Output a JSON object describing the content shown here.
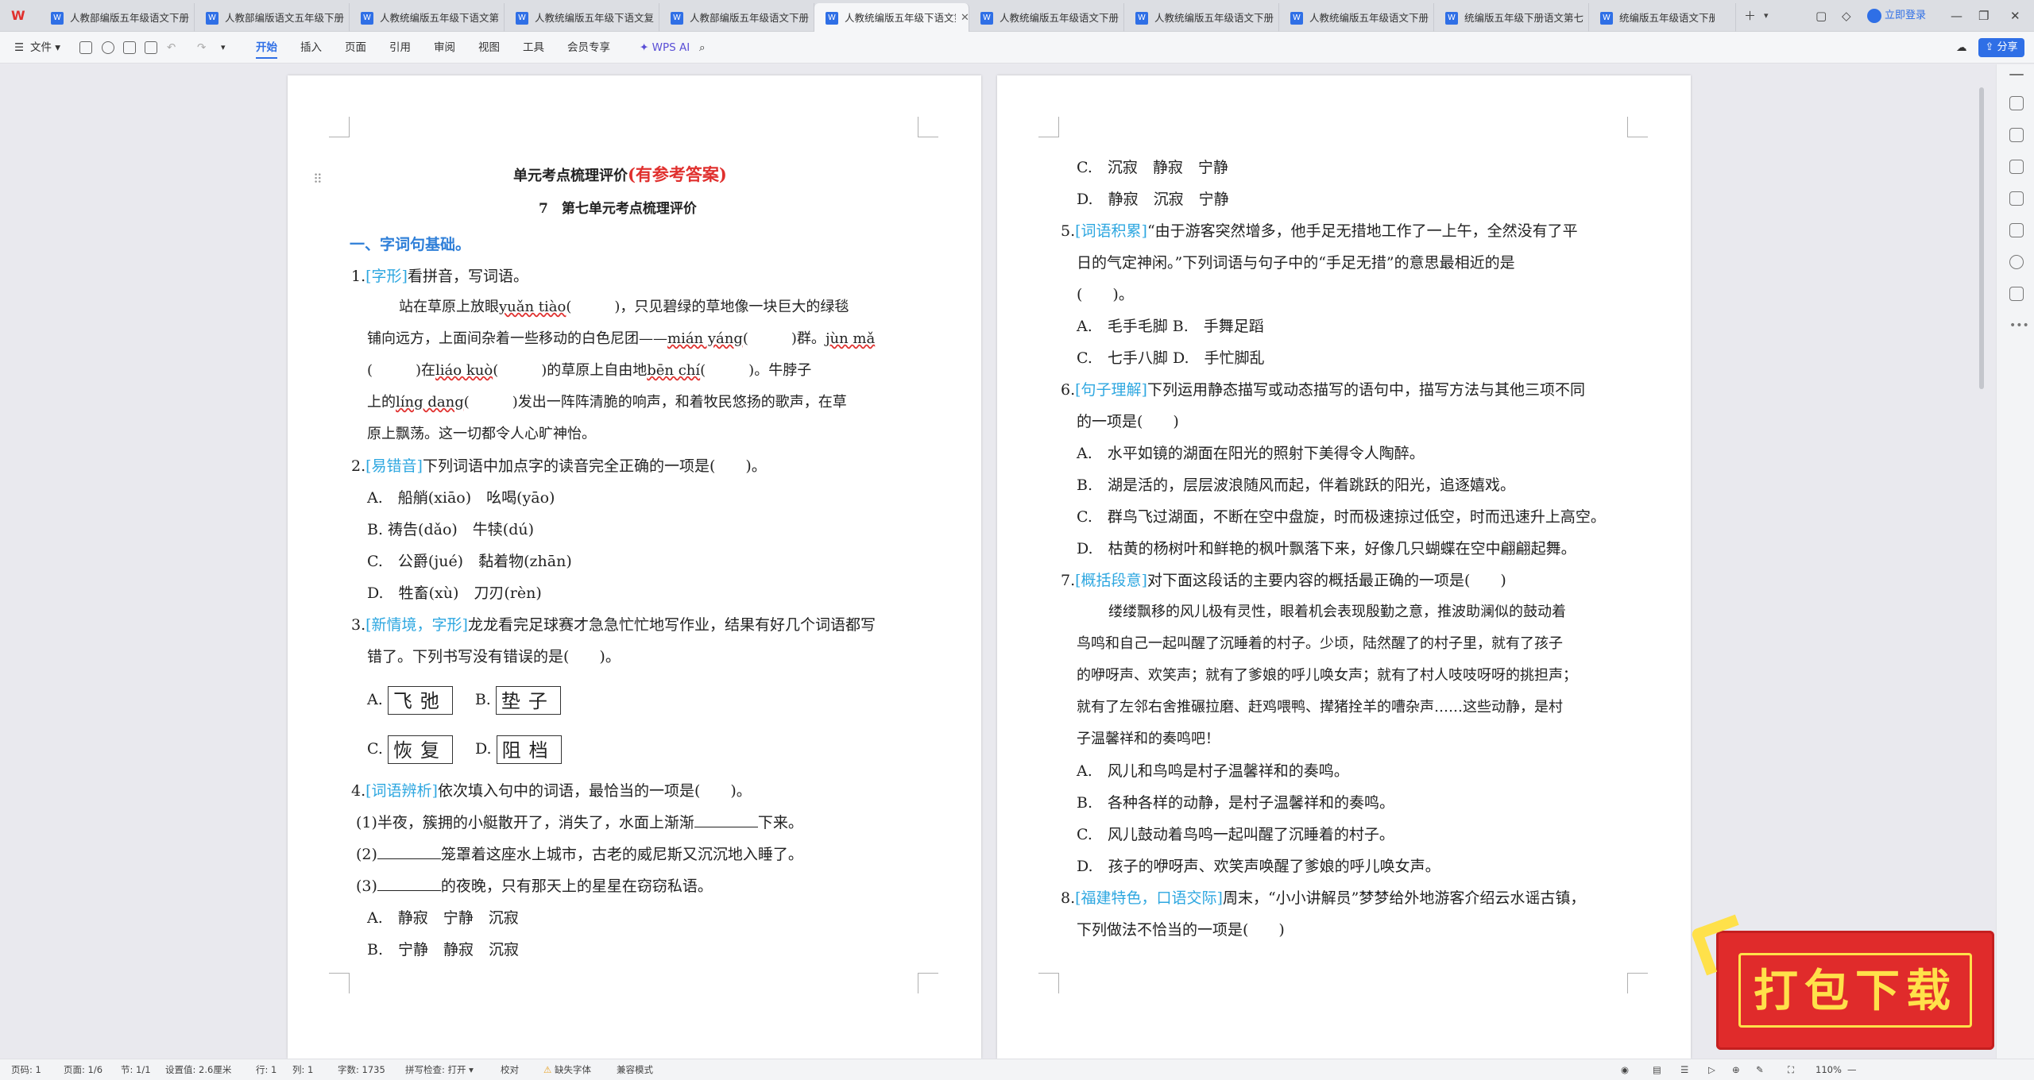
{
  "tabs": [
    {
      "label": "人教部编版五年级语文下册",
      "active": false
    },
    {
      "label": "人教部编版语文五年级下册",
      "active": false
    },
    {
      "label": "人教统编版五年级下语文第",
      "active": false
    },
    {
      "label": "人教统编版五年级下语文复",
      "active": false
    },
    {
      "label": "人教部编版五年级语文下册",
      "active": false
    },
    {
      "label": "人教统编版五年级下语文第",
      "active": true
    },
    {
      "label": "人教统编版五年级语文下册",
      "active": false
    },
    {
      "label": "人教统编版五年级语文下册",
      "active": false
    },
    {
      "label": "人教统编版五年级语文下册",
      "active": false
    },
    {
      "label": "统编版五年级下册语文第七",
      "active": false
    },
    {
      "label": "统编版五年级语文下册",
      "active": false
    }
  ],
  "login_label": "立即登录",
  "toolbar": {
    "file_label": "文件",
    "menus": [
      "开始",
      "插入",
      "页面",
      "引用",
      "审阅",
      "视图",
      "工具",
      "会员专享"
    ],
    "wps_ai": "WPS AI",
    "share": "分享"
  },
  "page1": {
    "title_main": "单元考点梳理评价",
    "title_answer": "(有参考答案)",
    "subtitle": "7　第七单元考点梳理评价",
    "section": "一、字词句基础。",
    "q1_num": "1.",
    "q1_tag": "[字形]",
    "q1_text": "看拼音，写词语。",
    "q1_p1a": "站在草原上放眼",
    "q1_py1": "yuǎn tiào",
    "q1_p1b": "(　　　)，只见碧绿的草地像一块巨大的绿毯",
    "q1_p2a": "铺向远方，上面间杂着一些移动的白色尼团——",
    "q1_py2": "mián yáng",
    "q1_p2b": "(　　　)群。",
    "q1_py3": "jùn mǎ",
    "q1_p3a": "(　　　)在",
    "q1_py4": "liáo kuò",
    "q1_p3b": "(　　　)的草原上自由地",
    "q1_py5": "bēn chí",
    "q1_p3c": "(　　　)。牛脖子",
    "q1_p4a": "上的",
    "q1_py6": "líng dang",
    "q1_p4b": "(　　　)发出一阵阵清脆的响声，和着牧民悠扬的歌声，在草",
    "q1_p5": "原上飘荡。这一切都令人心旷神怡。",
    "q2_num": "2.",
    "q2_tag": "[易错音]",
    "q2_text": "下列词语中加点字的读音完全正确的一项是(　　)。",
    "q2_a": "A.　船艄(xiāo)　吆喝(yāo)",
    "q2_b": "B. 祷告(dǎo)　牛犊(dú)",
    "q2_c": "C.　公爵(jué)　黏着物(zhān)",
    "q2_d": "D.　牲畜(xù)　刀刃(rèn)",
    "q3_num": "3.",
    "q3_tag": "[新情境，字形]",
    "q3_text1": "龙龙看完足球赛才急急忙忙地写作业，结果有好几个词语都写",
    "q3_text2": "错了。下列书写没有错误的是(　　)。",
    "q3_a_label": "A.",
    "q3_a_word": "飞弛",
    "q3_b_label": "B.",
    "q3_b_word": "垫子",
    "q3_c_label": "C.",
    "q3_c_word": "恢复",
    "q3_d_label": "D.",
    "q3_d_word": "阻档",
    "q4_num": "4.",
    "q4_tag": "[词语辨析]",
    "q4_text": "依次填入句中的词语，最恰当的一项是(　　)。",
    "q4_s1a": "(1)半夜，簇拥的小艇散开了，消失了，水面上渐渐",
    "q4_s1b": "下来。",
    "q4_s2a": "(2)",
    "q4_s2b": "笼罩着这座水上城市，古老的威尼斯又沉沉地入睡了。",
    "q4_s3a": "(3)",
    "q4_s3b": "的夜晚，只有那天上的星星在窃窃私语。",
    "q4_a": "A.　静寂　宁静　沉寂",
    "q4_b": "B.　宁静　静寂　沉寂"
  },
  "page2": {
    "q4_c": "C.　沉寂　静寂　宁静",
    "q4_d": "D.　静寂　沉寂　宁静",
    "q5_num": "5.",
    "q5_tag": "[词语积累]",
    "q5_text1": "“由于游客突然增多，他手足无措地工作了一上午，全然没有了平",
    "q5_text2": "日的气定神闲。”下列词语与句子中的“手足无措”的意思最相近的是",
    "q5_text3": "(　　)。",
    "q5_ab": "A.　毛手毛脚 B.　手舞足蹈",
    "q5_cd": "C.　七手八脚 D.　手忙脚乱",
    "q6_num": "6.",
    "q6_tag": "[句子理解]",
    "q6_text1": "下列运用静态描写或动态描写的语句中，描写方法与其他三项不同",
    "q6_text2": "的一项是(　　)",
    "q6_a": "A.　水平如镜的湖面在阳光的照射下美得令人陶醉。",
    "q6_b": "B.　湖是活的，层层波浪随风而起，伴着跳跃的阳光，追逐嬉戏。",
    "q6_c": "C.　群鸟飞过湖面，不断在空中盘旋，时而极速掠过低空，时而迅速升上高空。",
    "q6_d": "D.　枯黄的杨树叶和鲜艳的枫叶飘落下来，好像几只蝴蝶在空中翩翩起舞。",
    "q7_num": "7.",
    "q7_tag": "[概括段意]",
    "q7_text": "对下面这段话的主要内容的概括最正确的一项是(　　)",
    "q7_p1": "缕缕飘移的风儿极有灵性，眼着机会表现殷勤之意，推波助澜似的鼓动着",
    "q7_p2": "鸟鸣和自己一起叫醒了沉睡着的村子。少顷，陆然醒了的村子里，就有了孩子",
    "q7_p3": "的咿呀声、欢笑声；就有了爹娘的呼儿唤女声；就有了村人吱吱呀呀的挑担声；",
    "q7_p4": "就有了左邻右舍推碾拉磨、赶鸡喂鸭、撵猪拴羊的嘈杂声……这些动静，是村",
    "q7_p5": "子温馨祥和的奏鸣吧！",
    "q7_a": "A.　风儿和鸟鸣是村子温馨祥和的奏鸣。",
    "q7_b": "B.　各种各样的动静，是村子温馨祥和的奏鸣。",
    "q7_c": "C.　风儿鼓动着鸟鸣一起叫醒了沉睡着的村子。",
    "q7_d": "D.　孩子的咿呀声、欢笑声唤醒了爹娘的呼儿唤女声。",
    "q8_num": "8.",
    "q8_tag": "[福建特色，口语交际]",
    "q8_text1": "周末，“小小讲解员”梦梦给外地游客介绍云水谣古镇，",
    "q8_text2": "下列做法不恰当的一项是(　　)"
  },
  "status": {
    "page": "页码: 1",
    "pages": "页面: 1/6",
    "section": "节: 1/1",
    "setting": "设置值: 2.6厘米",
    "row": "行: 1",
    "col": "列: 1",
    "words": "字数: 1735",
    "spell": "拼写检查: 打开",
    "proof": "校对",
    "font_missing": "缺失字体",
    "compat": "兼容模式",
    "zoom": "110%"
  },
  "banner_text": "打包下载",
  "colors": {
    "accent": "#2f6fe6",
    "tag": "#2ea7e0",
    "title_red": "#e0302e",
    "section_blue": "#2f7fd8"
  }
}
